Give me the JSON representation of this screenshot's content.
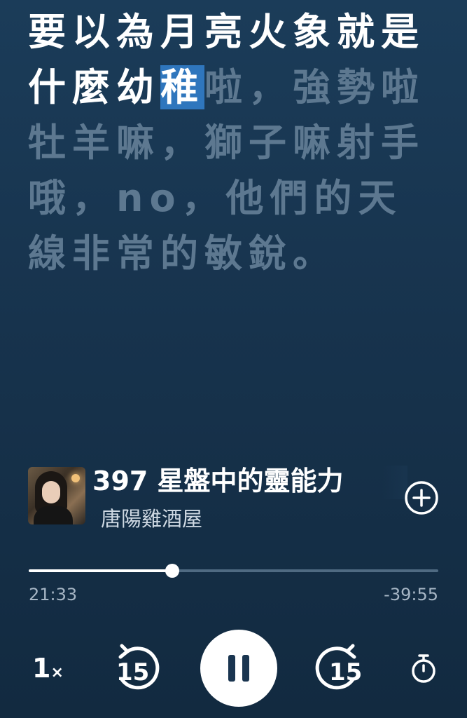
{
  "transcript": {
    "spoken": "要以為月亮火象就是什麼幼",
    "current_word": "稚",
    "upcoming": "啦，強勢啦牡羊嘛，獅子嘛射手哦，no，他們的天線非常的敏銳。"
  },
  "episode": {
    "title": "397 星盤中的靈能力",
    "show": "唐陽雞酒屋"
  },
  "player": {
    "elapsed": "21:33",
    "remaining": "-39:55",
    "progress_fraction": 0.35,
    "speed_value": "1",
    "speed_suffix": "×",
    "skip_back_seconds": "15",
    "skip_forward_seconds": "15"
  },
  "icons": {
    "add": "plus-circle-icon",
    "skip_back": "rewind-15-icon",
    "skip_forward": "forward-15-icon",
    "pause": "pause-icon",
    "sleep_timer": "stopwatch-icon"
  },
  "colors": {
    "background": "#1b3c59",
    "highlight": "#2f76bd",
    "upcoming_text": "#5d7890"
  }
}
